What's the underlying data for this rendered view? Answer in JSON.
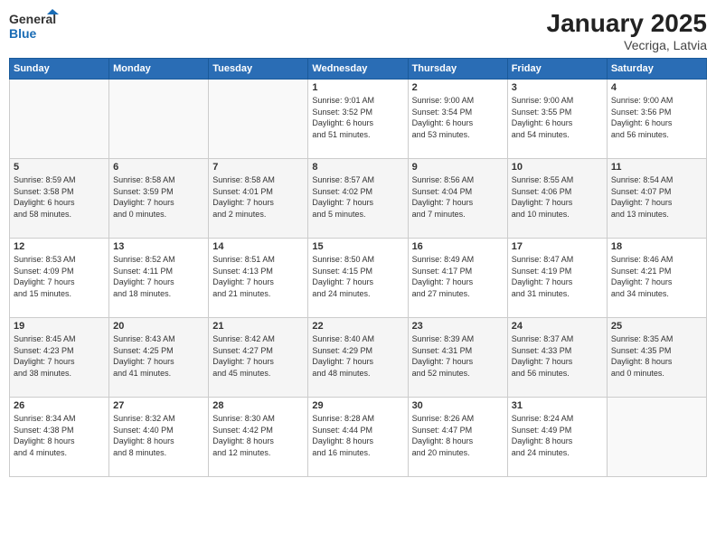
{
  "logo": {
    "line1": "General",
    "line2": "Blue"
  },
  "title": "January 2025",
  "subtitle": "Vecriga, Latvia",
  "weekdays": [
    "Sunday",
    "Monday",
    "Tuesday",
    "Wednesday",
    "Thursday",
    "Friday",
    "Saturday"
  ],
  "weeks": [
    [
      {
        "day": "",
        "info": ""
      },
      {
        "day": "",
        "info": ""
      },
      {
        "day": "",
        "info": ""
      },
      {
        "day": "1",
        "info": "Sunrise: 9:01 AM\nSunset: 3:52 PM\nDaylight: 6 hours\nand 51 minutes."
      },
      {
        "day": "2",
        "info": "Sunrise: 9:00 AM\nSunset: 3:54 PM\nDaylight: 6 hours\nand 53 minutes."
      },
      {
        "day": "3",
        "info": "Sunrise: 9:00 AM\nSunset: 3:55 PM\nDaylight: 6 hours\nand 54 minutes."
      },
      {
        "day": "4",
        "info": "Sunrise: 9:00 AM\nSunset: 3:56 PM\nDaylight: 6 hours\nand 56 minutes."
      }
    ],
    [
      {
        "day": "5",
        "info": "Sunrise: 8:59 AM\nSunset: 3:58 PM\nDaylight: 6 hours\nand 58 minutes."
      },
      {
        "day": "6",
        "info": "Sunrise: 8:58 AM\nSunset: 3:59 PM\nDaylight: 7 hours\nand 0 minutes."
      },
      {
        "day": "7",
        "info": "Sunrise: 8:58 AM\nSunset: 4:01 PM\nDaylight: 7 hours\nand 2 minutes."
      },
      {
        "day": "8",
        "info": "Sunrise: 8:57 AM\nSunset: 4:02 PM\nDaylight: 7 hours\nand 5 minutes."
      },
      {
        "day": "9",
        "info": "Sunrise: 8:56 AM\nSunset: 4:04 PM\nDaylight: 7 hours\nand 7 minutes."
      },
      {
        "day": "10",
        "info": "Sunrise: 8:55 AM\nSunset: 4:06 PM\nDaylight: 7 hours\nand 10 minutes."
      },
      {
        "day": "11",
        "info": "Sunrise: 8:54 AM\nSunset: 4:07 PM\nDaylight: 7 hours\nand 13 minutes."
      }
    ],
    [
      {
        "day": "12",
        "info": "Sunrise: 8:53 AM\nSunset: 4:09 PM\nDaylight: 7 hours\nand 15 minutes."
      },
      {
        "day": "13",
        "info": "Sunrise: 8:52 AM\nSunset: 4:11 PM\nDaylight: 7 hours\nand 18 minutes."
      },
      {
        "day": "14",
        "info": "Sunrise: 8:51 AM\nSunset: 4:13 PM\nDaylight: 7 hours\nand 21 minutes."
      },
      {
        "day": "15",
        "info": "Sunrise: 8:50 AM\nSunset: 4:15 PM\nDaylight: 7 hours\nand 24 minutes."
      },
      {
        "day": "16",
        "info": "Sunrise: 8:49 AM\nSunset: 4:17 PM\nDaylight: 7 hours\nand 27 minutes."
      },
      {
        "day": "17",
        "info": "Sunrise: 8:47 AM\nSunset: 4:19 PM\nDaylight: 7 hours\nand 31 minutes."
      },
      {
        "day": "18",
        "info": "Sunrise: 8:46 AM\nSunset: 4:21 PM\nDaylight: 7 hours\nand 34 minutes."
      }
    ],
    [
      {
        "day": "19",
        "info": "Sunrise: 8:45 AM\nSunset: 4:23 PM\nDaylight: 7 hours\nand 38 minutes."
      },
      {
        "day": "20",
        "info": "Sunrise: 8:43 AM\nSunset: 4:25 PM\nDaylight: 7 hours\nand 41 minutes."
      },
      {
        "day": "21",
        "info": "Sunrise: 8:42 AM\nSunset: 4:27 PM\nDaylight: 7 hours\nand 45 minutes."
      },
      {
        "day": "22",
        "info": "Sunrise: 8:40 AM\nSunset: 4:29 PM\nDaylight: 7 hours\nand 48 minutes."
      },
      {
        "day": "23",
        "info": "Sunrise: 8:39 AM\nSunset: 4:31 PM\nDaylight: 7 hours\nand 52 minutes."
      },
      {
        "day": "24",
        "info": "Sunrise: 8:37 AM\nSunset: 4:33 PM\nDaylight: 7 hours\nand 56 minutes."
      },
      {
        "day": "25",
        "info": "Sunrise: 8:35 AM\nSunset: 4:35 PM\nDaylight: 8 hours\nand 0 minutes."
      }
    ],
    [
      {
        "day": "26",
        "info": "Sunrise: 8:34 AM\nSunset: 4:38 PM\nDaylight: 8 hours\nand 4 minutes."
      },
      {
        "day": "27",
        "info": "Sunrise: 8:32 AM\nSunset: 4:40 PM\nDaylight: 8 hours\nand 8 minutes."
      },
      {
        "day": "28",
        "info": "Sunrise: 8:30 AM\nSunset: 4:42 PM\nDaylight: 8 hours\nand 12 minutes."
      },
      {
        "day": "29",
        "info": "Sunrise: 8:28 AM\nSunset: 4:44 PM\nDaylight: 8 hours\nand 16 minutes."
      },
      {
        "day": "30",
        "info": "Sunrise: 8:26 AM\nSunset: 4:47 PM\nDaylight: 8 hours\nand 20 minutes."
      },
      {
        "day": "31",
        "info": "Sunrise: 8:24 AM\nSunset: 4:49 PM\nDaylight: 8 hours\nand 24 minutes."
      },
      {
        "day": "",
        "info": ""
      }
    ]
  ]
}
